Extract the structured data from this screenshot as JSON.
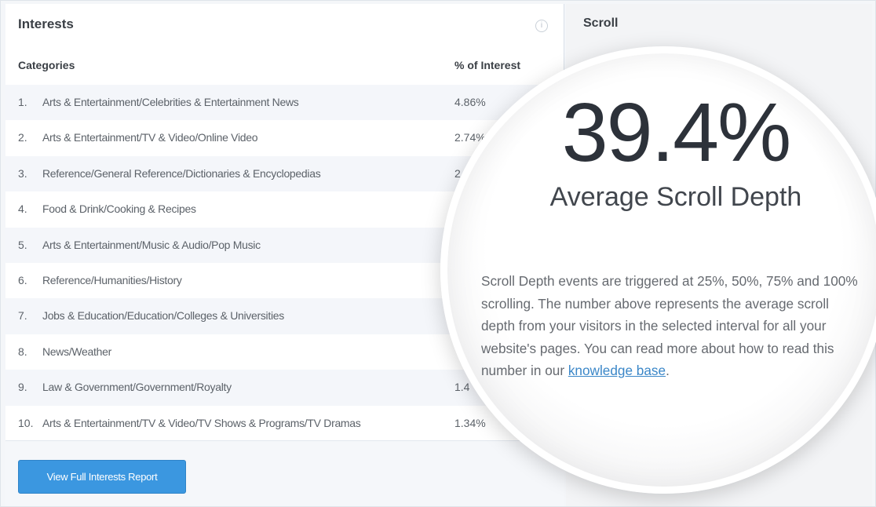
{
  "interests": {
    "title": "Interests",
    "info_icon": "info-icon",
    "columns": {
      "category": "Categories",
      "percent": "% of Interest"
    },
    "rows": [
      {
        "num": "1.",
        "category": "Arts & Entertainment/Celebrities & Entertainment News",
        "percent": "4.86%"
      },
      {
        "num": "2.",
        "category": "Arts & Entertainment/TV & Video/Online Video",
        "percent": "2.74%"
      },
      {
        "num": "3.",
        "category": "Reference/General Reference/Dictionaries & Encyclopedias",
        "percent": "2"
      },
      {
        "num": "4.",
        "category": "Food & Drink/Cooking & Recipes",
        "percent": ""
      },
      {
        "num": "5.",
        "category": "Arts & Entertainment/Music & Audio/Pop Music",
        "percent": ""
      },
      {
        "num": "6.",
        "category": "Reference/Humanities/History",
        "percent": ""
      },
      {
        "num": "7.",
        "category": "Jobs & Education/Education/Colleges & Universities",
        "percent": ""
      },
      {
        "num": "8.",
        "category": "News/Weather",
        "percent": ""
      },
      {
        "num": "9.",
        "category": "Law & Government/Government/Royalty",
        "percent": "1.4"
      },
      {
        "num": "10.",
        "category": "Arts & Entertainment/TV & Video/TV Shows & Programs/TV Dramas",
        "percent": "1.34%"
      }
    ],
    "button_label": "View Full Interests Report"
  },
  "scroll": {
    "title": "Scroll",
    "value": "39.4%",
    "label": "Average Scroll Depth",
    "description": "Scroll Depth events are triggered at 25%, 50%, 75% and 100% scrolling. The number above represents the average scroll depth from your visitors in the selected interval for all your website's pages. You can read more about how to read this number in our ",
    "link_text": "knowledge base",
    "trailing": "."
  },
  "colors": {
    "button": "#3b97e0",
    "link": "#3b87c8",
    "text_dark": "#2d323a"
  }
}
